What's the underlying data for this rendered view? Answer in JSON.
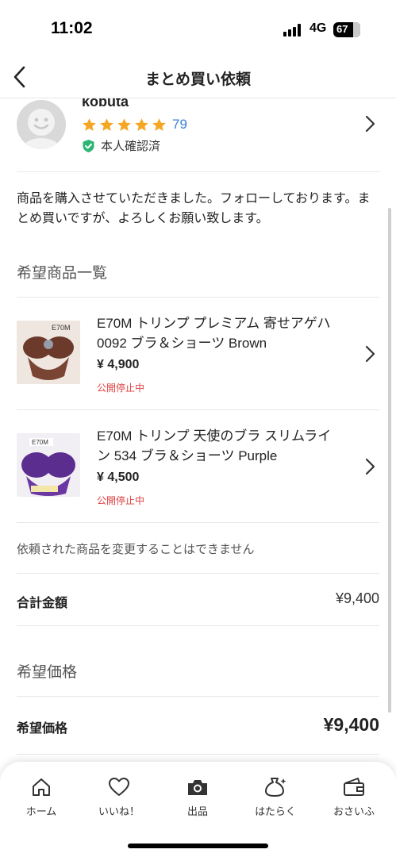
{
  "status_bar": {
    "time": "11:02",
    "network": "4G",
    "battery": "67"
  },
  "header": {
    "title": "まとめ買い依頼",
    "back_icon": "chevron-left-icon"
  },
  "seller": {
    "name": "kobuta",
    "rating_stars": 5,
    "rating_count": "79",
    "verified_label": "本人確認済"
  },
  "message": "商品を購入させていただきました。フォローしております。まとめ買いですが、よろしくお願い致します。",
  "items_section_title": "希望商品一覧",
  "items": [
    {
      "title": "E70M トリンプ プレミアム 寄せアゲハ 0092 ブラ＆ショーツ Brown",
      "price": "¥ 4,900",
      "status": "公開停止中",
      "thumb_label": "E70M",
      "thumb_color": "#6b3a2a"
    },
    {
      "title": "E70M トリンプ 天使のブラ スリムライン 534 ブラ＆ショーツ Purple",
      "price": "¥ 4,500",
      "status": "公開停止中",
      "thumb_label": "E70M",
      "thumb_color": "#5b2d8e"
    }
  ],
  "notice": "依頼された商品を変更することはできません",
  "total": {
    "label": "合計金額",
    "value": "¥9,400"
  },
  "desired_section_title": "希望価格",
  "desired": {
    "label": "希望価格",
    "value": "¥9,400"
  },
  "tabbar": [
    {
      "label": "ホーム",
      "icon": "home-icon"
    },
    {
      "label": "いいね！",
      "icon": "heart-icon"
    },
    {
      "label": "出品",
      "icon": "camera-icon"
    },
    {
      "label": "はたらく",
      "icon": "money-bag-icon"
    },
    {
      "label": "おさいふ",
      "icon": "wallet-icon"
    }
  ],
  "colors": {
    "accent_blue": "#3b7dd8",
    "star": "#f5a623",
    "status_red": "#e03e3e",
    "verified_green": "#2bb673"
  }
}
